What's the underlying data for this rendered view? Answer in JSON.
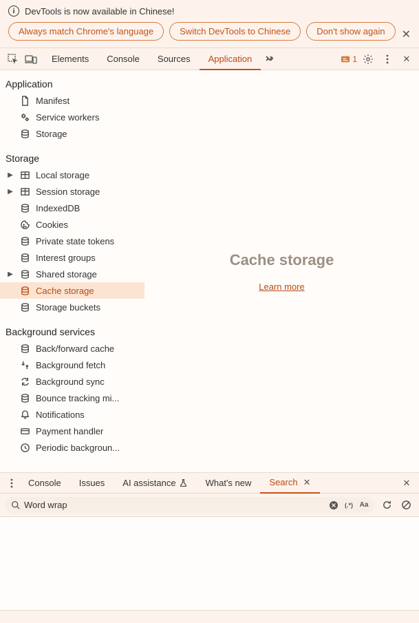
{
  "infobar": {
    "message": "DevTools is now available in Chinese!",
    "chips": [
      "Always match Chrome's language",
      "Switch DevTools to Chinese",
      "Don't show again"
    ]
  },
  "toolbar": {
    "tabs": [
      "Elements",
      "Console",
      "Sources",
      "Application"
    ],
    "active_tab": "Application",
    "issues_count": "1"
  },
  "sidebar": {
    "categories": [
      {
        "title": "Application",
        "items": [
          {
            "label": "Manifest",
            "icon": "document",
            "expandable": false
          },
          {
            "label": "Service workers",
            "icon": "gears",
            "expandable": false
          },
          {
            "label": "Storage",
            "icon": "database",
            "expandable": false
          }
        ]
      },
      {
        "title": "Storage",
        "items": [
          {
            "label": "Local storage",
            "icon": "table",
            "expandable": true
          },
          {
            "label": "Session storage",
            "icon": "table",
            "expandable": true
          },
          {
            "label": "IndexedDB",
            "icon": "database",
            "expandable": false
          },
          {
            "label": "Cookies",
            "icon": "cookie",
            "expandable": false
          },
          {
            "label": "Private state tokens",
            "icon": "database",
            "expandable": false
          },
          {
            "label": "Interest groups",
            "icon": "database",
            "expandable": false
          },
          {
            "label": "Shared storage",
            "icon": "database",
            "expandable": true
          },
          {
            "label": "Cache storage",
            "icon": "database",
            "expandable": false,
            "selected": true
          },
          {
            "label": "Storage buckets",
            "icon": "database",
            "expandable": false
          }
        ]
      },
      {
        "title": "Background services",
        "items": [
          {
            "label": "Back/forward cache",
            "icon": "database",
            "expandable": false
          },
          {
            "label": "Background fetch",
            "icon": "fetch",
            "expandable": false
          },
          {
            "label": "Background sync",
            "icon": "sync",
            "expandable": false
          },
          {
            "label": "Bounce tracking mi...",
            "icon": "database",
            "expandable": false
          },
          {
            "label": "Notifications",
            "icon": "bell",
            "expandable": false
          },
          {
            "label": "Payment handler",
            "icon": "card",
            "expandable": false
          },
          {
            "label": "Periodic backgroun...",
            "icon": "clock",
            "expandable": false
          }
        ]
      }
    ]
  },
  "detail": {
    "title": "Cache storage",
    "learn_more": "Learn more"
  },
  "drawer": {
    "tabs": [
      "Console",
      "Issues",
      "AI assistance",
      "What's new",
      "Search"
    ],
    "active_tab": "Search",
    "search_value": "Word wrap",
    "regex_label": ".*",
    "case_label": "Aa"
  }
}
